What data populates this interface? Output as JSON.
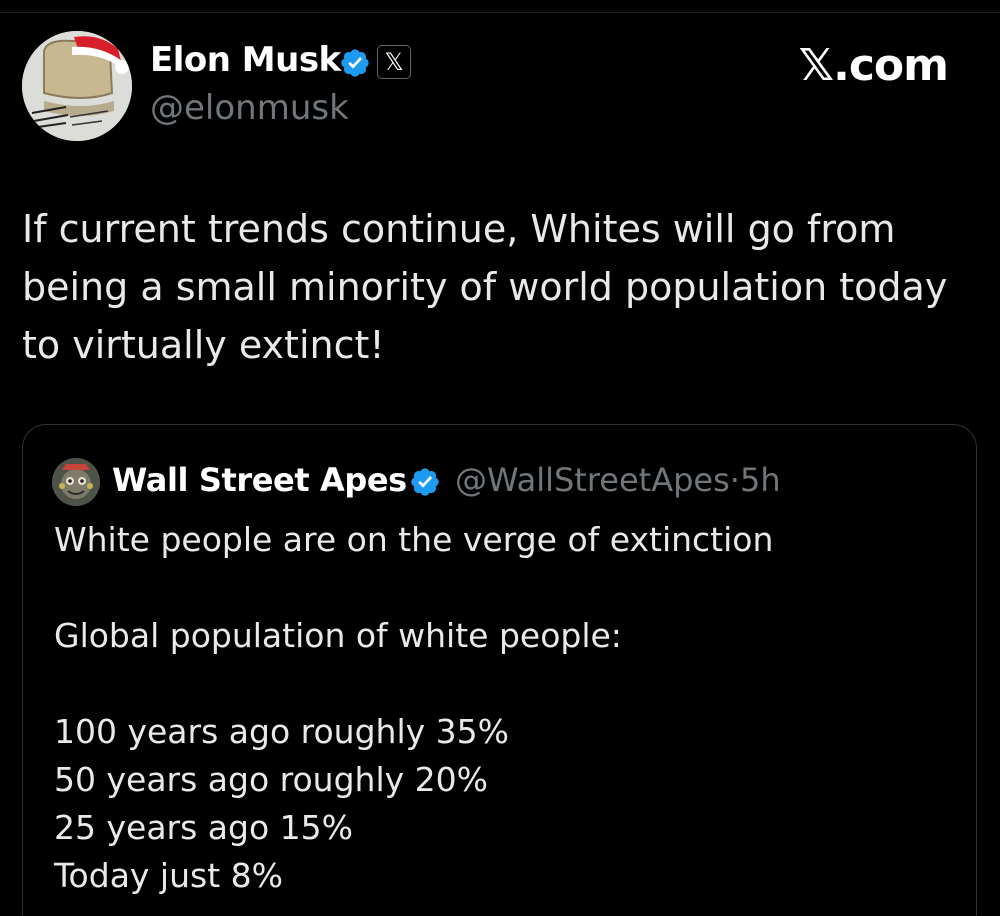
{
  "author": {
    "name": "Elon Musk",
    "handle": "@elonmusk",
    "verified_badge_color": "#1d9bf0",
    "affiliation_badge_icon": "x-logo-icon",
    "affiliation_badge_glyph": "𝕏"
  },
  "watermark": {
    "label": "𝕏.com"
  },
  "tweet": {
    "text": "If current trends continue, Whites will go from being a small minority of world population today to virtually extinct!"
  },
  "quoted_tweet": {
    "author_name": "Wall Street Apes",
    "author_handle": "@WallStreetApes",
    "separator": "·",
    "time_ago": "5h",
    "lines": [
      "White people are on the verge of extinction",
      "Global population of white people:",
      "100 years ago roughly 35%",
      "50 years ago roughly 20%",
      "25 years ago 15%",
      "Today just 8%"
    ]
  },
  "colors": {
    "background": "#000000",
    "primary_text": "#e7e9ea",
    "secondary_text": "#71767b",
    "card_border": "#2f3336",
    "verified_blue": "#1d9bf0"
  }
}
